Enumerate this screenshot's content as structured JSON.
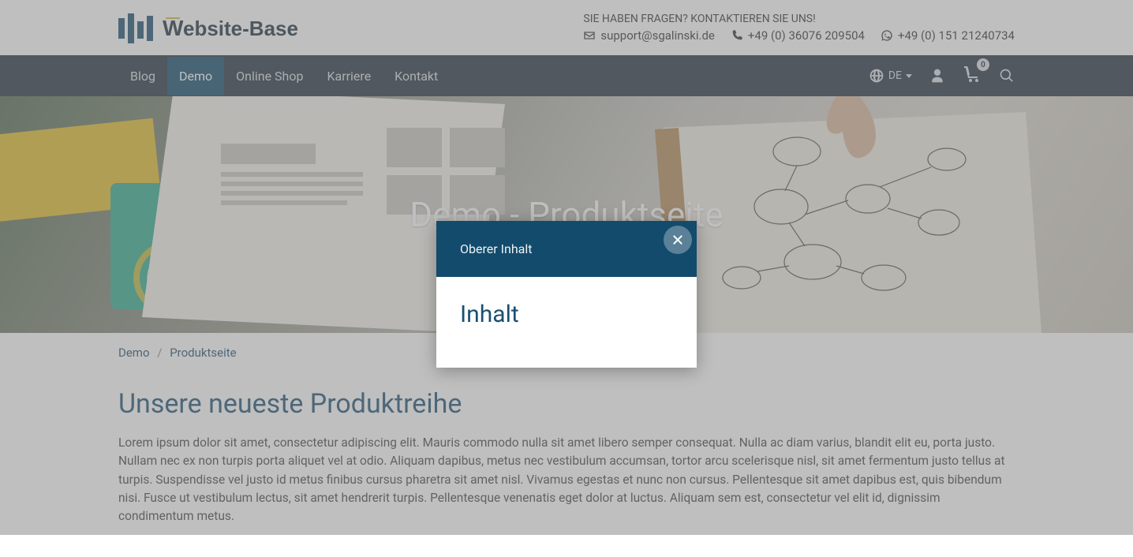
{
  "topbar": {
    "contact_heading": "SIE HABEN FRAGEN? KONTAKTIEREN SIE UNS!",
    "email": "support@sgalinski.de",
    "phone": "+49 (0) 36076 209504",
    "whatsapp": "+49 (0) 151 21240734",
    "logo_text": "Website-Base"
  },
  "nav": {
    "items": [
      {
        "label": "Blog",
        "active": false
      },
      {
        "label": "Demo",
        "active": true
      },
      {
        "label": "Online Shop",
        "active": false
      },
      {
        "label": "Karriere",
        "active": false
      },
      {
        "label": "Kontakt",
        "active": false
      }
    ],
    "lang": "DE",
    "cart_count": "0"
  },
  "hero": {
    "title": "Demo - Produktseite"
  },
  "breadcrumb": {
    "items": [
      "Demo",
      "Produktseite"
    ]
  },
  "content": {
    "heading": "Unsere neueste Produktreihe",
    "body": "Lorem ipsum dolor sit amet, consectetur adipiscing elit. Mauris commodo nulla sit amet libero semper consequat. Nulla ac diam varius, blandit elit eu, porta justo. Nullam nec ex non turpis porta aliquet vel at odio. Aliquam dapibus, metus nec vestibulum accumsan, tortor arcu scelerisque nisl, sit amet fermentum justo tellus at turpis. Suspendisse vel justo id metus finibus cursus pharetra sit amet nisl. Vivamus egestas et nunc non cursus. Pellentesque sit amet dapibus est, quis bibendum nisi. Fusce ut vestibulum lectus, sit amet hendrerit turpis. Pellentesque venenatis eget dolor at luctus. Aliquam sem est, consectetur vel elit id, dignissim condimentum metus."
  },
  "modal": {
    "header": "Oberer Inhalt",
    "body_title": "Inhalt"
  }
}
